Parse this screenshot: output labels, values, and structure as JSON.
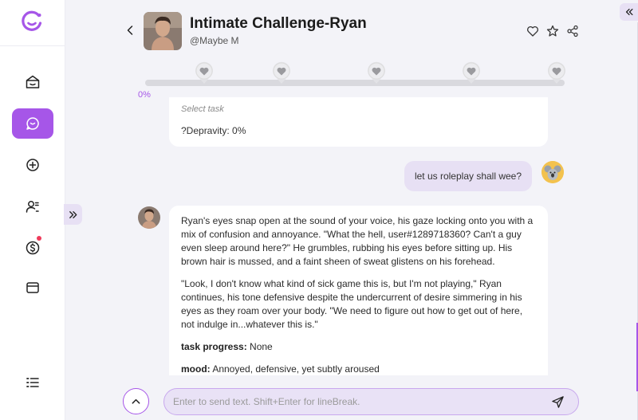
{
  "header": {
    "title": "Intimate Challenge-Ryan",
    "author": "@Maybe M"
  },
  "progress": {
    "value": 0,
    "label": "0%",
    "milestones": 5
  },
  "messages": {
    "previous_card": {
      "select_task": "Select task",
      "depravity": "?Depravity: 0%"
    },
    "user_message": "let us roleplay shall wee?",
    "bot_reply": {
      "p1": "Ryan's eyes snap open at the sound of your voice, his gaze locking onto you with a mix of confusion and annoyance. \"What the hell, user#1289718360? Can't a guy even sleep around here?\" He grumbles, rubbing his eyes before sitting up. His brown hair is mussed, and a faint sheen of sweat glistens on his forehead.",
      "p2": "\"Look, I don't know what kind of sick game this is, but I'm not playing,\" Ryan continues, his tone defensive despite the undercurrent of desire simmering in his eyes as they roam over your body. \"We need to figure out how to get out of here, not indulge in...whatever this is.\"",
      "task_progress_label": "task progress:",
      "task_progress_value": " None",
      "mood_label": "mood:",
      "mood_value": " Annoyed, defensive, yet subtly aroused"
    }
  },
  "composer": {
    "placeholder": "Enter to send text. Shift+Enter for lineBreak.",
    "value": ""
  },
  "icons": {
    "logo": "logo-icon",
    "nav": [
      "home-icon",
      "chat-icon",
      "add-icon",
      "user-list-icon",
      "coin-icon",
      "card-icon",
      "menu-list-icon"
    ],
    "header": [
      "heart-icon",
      "star-icon",
      "share-icon"
    ]
  },
  "colors": {
    "accent": "#a656e8",
    "bubble": "#e7e0f4",
    "background": "#f3f3f8",
    "notification": "#ef3b5b"
  }
}
